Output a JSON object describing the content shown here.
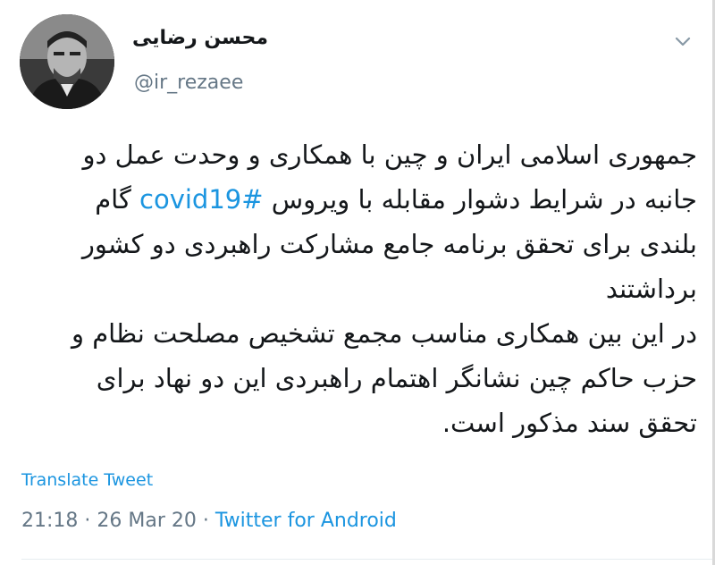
{
  "author": {
    "display_name": "محسن رضایی",
    "handle": "@ir_rezaee",
    "avatar_icon": "profile-photo"
  },
  "tweet": {
    "paragraph1_before": "جمهوری اسلامی ایران و چین با همکاری و وحدت عمل دو جانبه در شرایط دشوار مقابله با ویروس ",
    "hashtag": "#covid19",
    "paragraph1_after": " گام بلندی برای تحقق برنامه جامع مشارکت راهبردی دو کشور برداشتند",
    "paragraph2": "در این بین همکاری مناسب مجمع تشخیص مصلحت نظام و حزب حاکم چین نشانگر اهتمام راهبردی این دو نهاد برای تحقق سند مذکور است."
  },
  "translate_label": "Translate Tweet",
  "meta": {
    "time": "21:18",
    "separator": " · ",
    "date": "26 Mar 20",
    "source": "Twitter for Android"
  },
  "colors": {
    "link": "#1b95e0",
    "secondary": "#657786",
    "text": "#14171a"
  }
}
